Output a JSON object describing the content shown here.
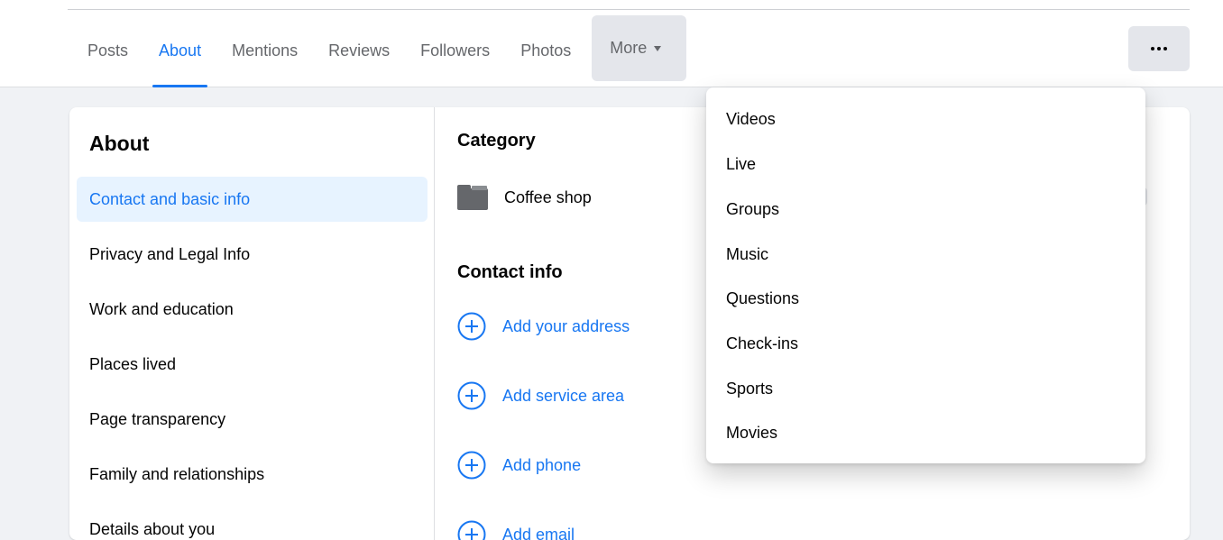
{
  "nav": {
    "tabs": [
      {
        "label": "Posts"
      },
      {
        "label": "About"
      },
      {
        "label": "Mentions"
      },
      {
        "label": "Reviews"
      },
      {
        "label": "Followers"
      },
      {
        "label": "Photos"
      }
    ],
    "more_label": "More",
    "active_tab": "About",
    "more_options_icon": "ellipsis-icon"
  },
  "about": {
    "title": "About",
    "sidebar": [
      {
        "label": "Contact and basic info",
        "active": true
      },
      {
        "label": "Privacy and Legal Info"
      },
      {
        "label": "Work and education"
      },
      {
        "label": "Places lived"
      },
      {
        "label": "Page transparency"
      },
      {
        "label": "Family and relationships"
      },
      {
        "label": "Details about you"
      }
    ]
  },
  "content": {
    "category_title": "Category",
    "category_value": "Coffee shop",
    "category_icon": "folder-icon",
    "contact_title": "Contact info",
    "actions": [
      {
        "label": "Add your address",
        "icon": "plus-circle-icon"
      },
      {
        "label": "Add service area",
        "icon": "plus-circle-icon"
      },
      {
        "label": "Add phone",
        "icon": "plus-circle-icon"
      },
      {
        "label": "Add email",
        "icon": "plus-circle-icon"
      }
    ]
  },
  "more_menu": {
    "items": [
      {
        "label": "Videos"
      },
      {
        "label": "Live"
      },
      {
        "label": "Groups"
      },
      {
        "label": "Music"
      },
      {
        "label": "Questions"
      },
      {
        "label": "Check-ins"
      },
      {
        "label": "Sports"
      },
      {
        "label": "Movies"
      }
    ]
  },
  "colors": {
    "accent": "#1877f2",
    "active_bg": "#e7f3ff",
    "button_bg": "#e4e6eb",
    "page_bg": "#f0f2f5"
  }
}
